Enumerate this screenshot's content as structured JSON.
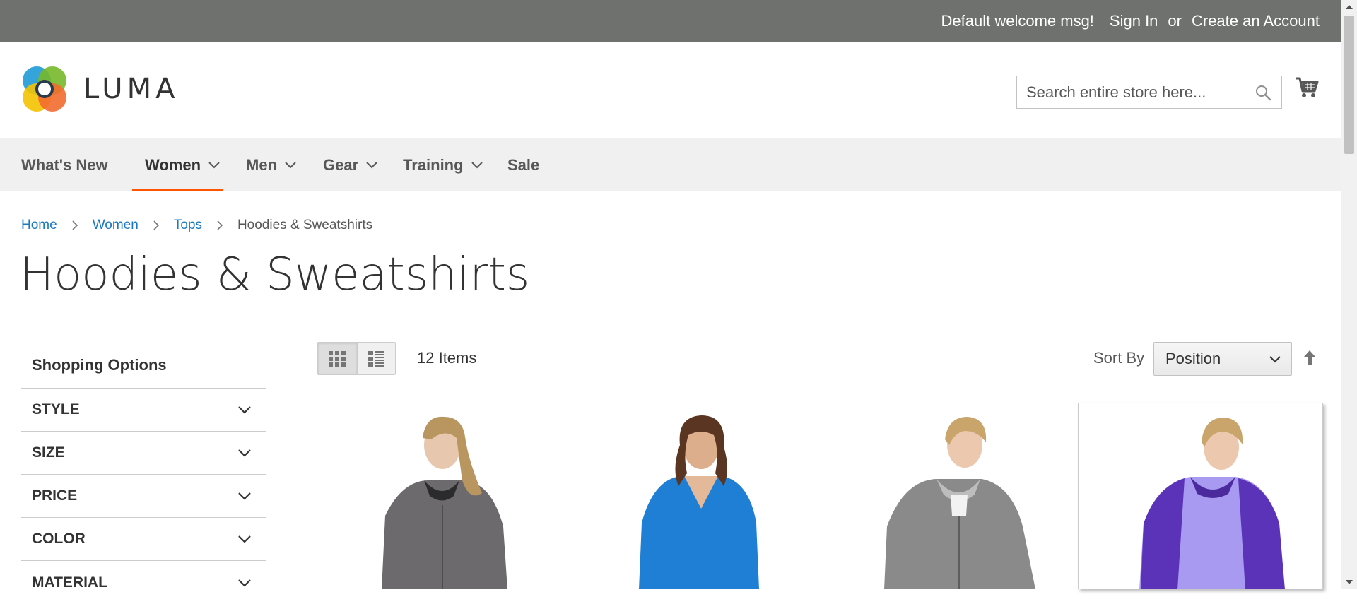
{
  "top_bar": {
    "welcome": "Default welcome msg!",
    "sign_in": "Sign In",
    "or": "or",
    "create_account": "Create an Account",
    "bg_color": "#6e716e"
  },
  "header": {
    "logo_text": "LUMA",
    "search_placeholder": "Search entire store here...",
    "cart_icon": "shopping-cart-icon"
  },
  "nav": {
    "items": [
      {
        "label": "What's New",
        "dropdown": false
      },
      {
        "label": "Women",
        "dropdown": true,
        "active": true
      },
      {
        "label": "Men",
        "dropdown": true
      },
      {
        "label": "Gear",
        "dropdown": true
      },
      {
        "label": "Training",
        "dropdown": true
      },
      {
        "label": "Sale",
        "dropdown": false
      }
    ],
    "active_color": "#ff5501"
  },
  "breadcrumb": {
    "items": [
      "Home",
      "Women",
      "Tops"
    ],
    "current": "Hoodies & Sweatshirts"
  },
  "page_title": "Hoodies & Sweatshirts",
  "sidebar": {
    "title": "Shopping Options",
    "filters": [
      "STYLE",
      "SIZE",
      "PRICE",
      "COLOR",
      "MATERIAL"
    ]
  },
  "toolbar": {
    "view_modes": [
      "grid-icon",
      "list-icon"
    ],
    "active_mode": "grid",
    "item_count": "12 Items",
    "sort_label": "Sort By",
    "sort_value": "Position",
    "sort_direction_icon": "arrow-up-icon"
  },
  "products": [
    {
      "image": "woman in grey zip hoodie",
      "color": "#6e6b6f"
    },
    {
      "image": "woman in blue v-neck top",
      "color": "#1f7fd4"
    },
    {
      "image": "woman in heather grey zip hoodie",
      "color": "#8a8a8a"
    },
    {
      "image": "woman in lavender and purple hoodie",
      "color": "#a79af0"
    }
  ]
}
